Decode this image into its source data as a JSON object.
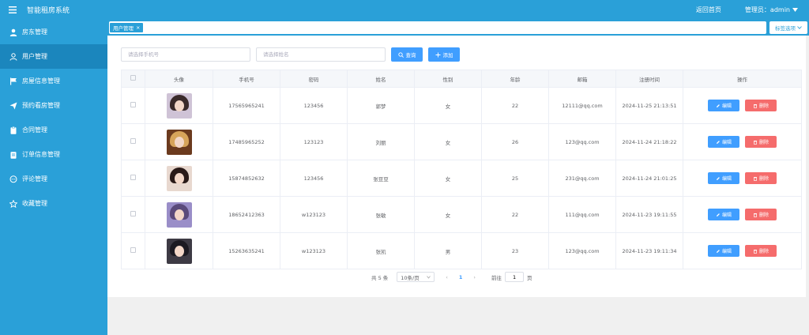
{
  "header": {
    "menu_icon": "hamburger-icon",
    "title": "智能租房系统",
    "home_link": "返回首页",
    "admin_label": "管理员：admin"
  },
  "sidebar": {
    "items": [
      {
        "label": "房东管理",
        "icon": "user-icon"
      },
      {
        "label": "用户管理",
        "icon": "user-outline-icon",
        "active": true
      },
      {
        "label": "房屋信息管理",
        "icon": "flag-icon"
      },
      {
        "label": "预约看房管理",
        "icon": "send-icon"
      },
      {
        "label": "合同管理",
        "icon": "clipboard-icon"
      },
      {
        "label": "订单信息管理",
        "icon": "document-icon"
      },
      {
        "label": "评论管理",
        "icon": "chat-icon"
      },
      {
        "label": "收藏管理",
        "icon": "star-icon"
      }
    ]
  },
  "tabs": {
    "active_tab": "用户管理",
    "options_label": "标签选项"
  },
  "search": {
    "phone_placeholder": "请选择手机号",
    "name_placeholder": "请选择姓名",
    "search_label": "查询",
    "add_label": "添加"
  },
  "table": {
    "columns": [
      "头像",
      "手机号",
      "密码",
      "姓名",
      "性别",
      "年龄",
      "邮箱",
      "注册时间",
      "操作"
    ],
    "edit_label": "编辑",
    "delete_label": "删除",
    "rows": [
      {
        "phone": "17565965241",
        "password": "123456",
        "name": "郭梦",
        "gender": "女",
        "age": "22",
        "email": "12111@qq.com",
        "registered": "2024-11-25 21:13:51"
      },
      {
        "phone": "17485965252",
        "password": "123123",
        "name": "刘丽",
        "gender": "女",
        "age": "26",
        "email": "123@qq.com",
        "registered": "2024-11-24 21:18:22"
      },
      {
        "phone": "15874852632",
        "password": "123456",
        "name": "张豆豆",
        "gender": "女",
        "age": "25",
        "email": "231@qq.com",
        "registered": "2024-11-24 21:01:25"
      },
      {
        "phone": "18652412363",
        "password": "w123123",
        "name": "张敏",
        "gender": "女",
        "age": "22",
        "email": "111@qq.com",
        "registered": "2024-11-23 19:11:55"
      },
      {
        "phone": "15263635241",
        "password": "w123123",
        "name": "张凯",
        "gender": "男",
        "age": "23",
        "email": "123@qq.com",
        "registered": "2024-11-23 19:11:34"
      }
    ]
  },
  "pagination": {
    "total": "共 5 条",
    "page_size": "10条/页",
    "current_page": "1",
    "goto_label": "前往",
    "goto_value": "1",
    "page_unit": "页"
  },
  "colors": {
    "primary": "#2aa0d8",
    "sidebar_active": "#1b86bd",
    "button_blue": "#409eff",
    "button_red": "#f56c6c"
  }
}
